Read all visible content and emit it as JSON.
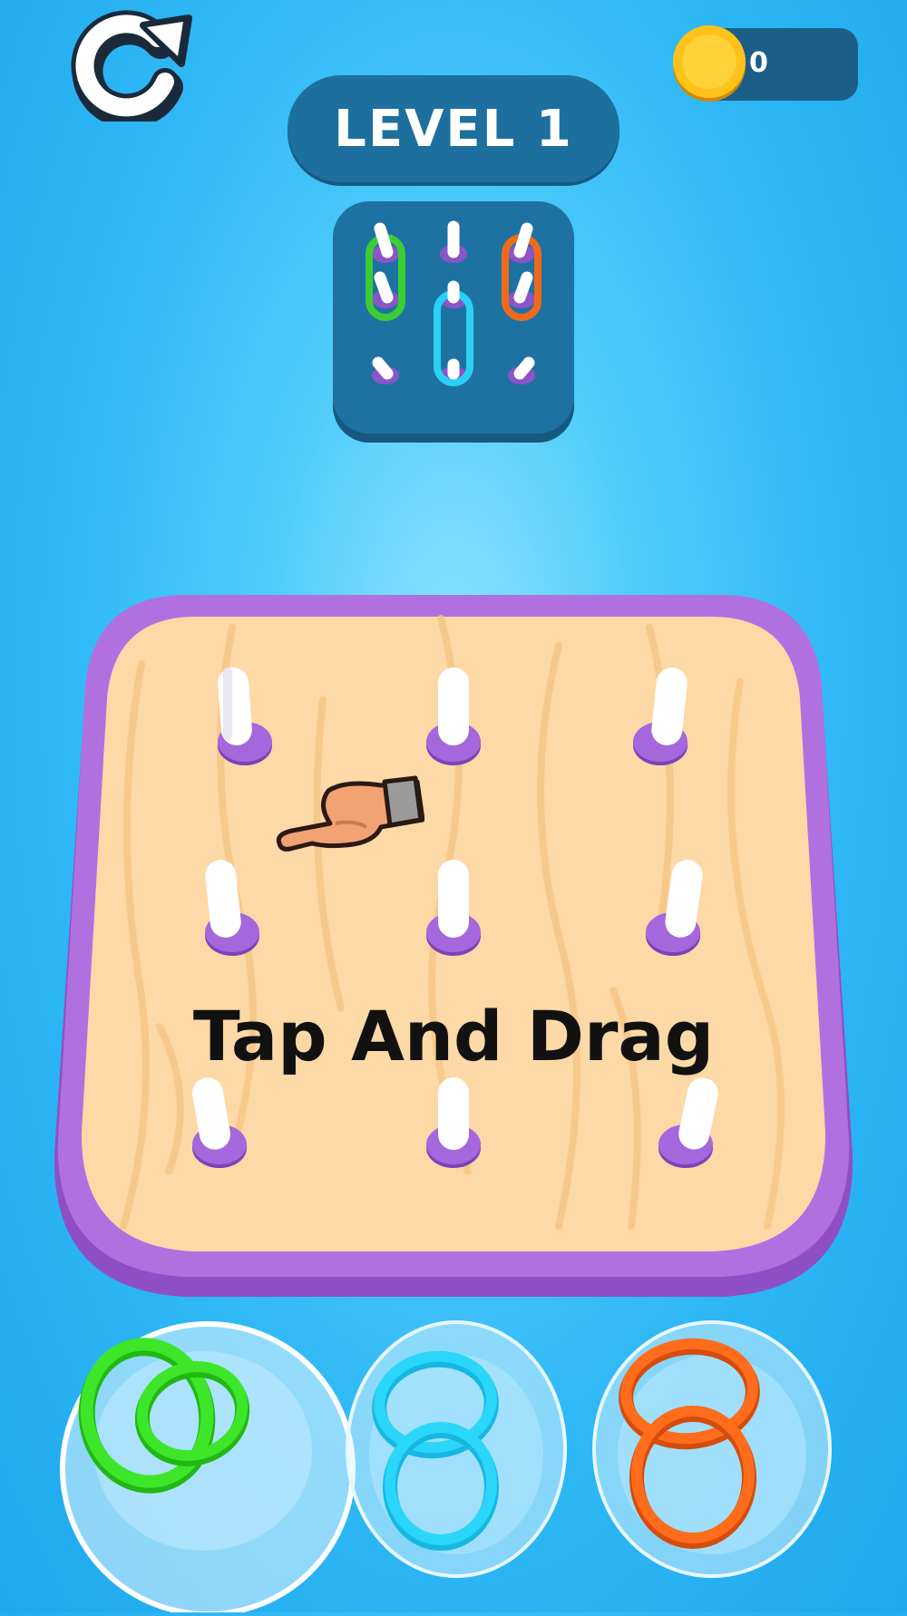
{
  "hud": {
    "restart_icon": "restart-arrow-icon",
    "coin_icon": "gold-coin-icon",
    "coin_count": "0",
    "level_label": "LEVEL 1"
  },
  "preview": {
    "icon": "target-pattern-preview",
    "pegs": 9,
    "rings": [
      "green",
      "cyan",
      "orange"
    ]
  },
  "board": {
    "pegs": 9,
    "hint": "Tap And Drag",
    "hand_icon": "pointing-hand-icon"
  },
  "bowls": [
    {
      "color": "green",
      "hex": "#2fdc1e",
      "rings": 2
    },
    {
      "color": "cyan",
      "hex": "#28d4f8",
      "rings": 2
    },
    {
      "color": "orange",
      "hex": "#ff6a1a",
      "rings": 2
    }
  ],
  "colors": {
    "background": "#2fb8f5",
    "board_rim": "#a86ad8",
    "board_wood": "#fcd9a4",
    "peg_base": "#9a5bd6",
    "panel": "#1d6f9e"
  }
}
